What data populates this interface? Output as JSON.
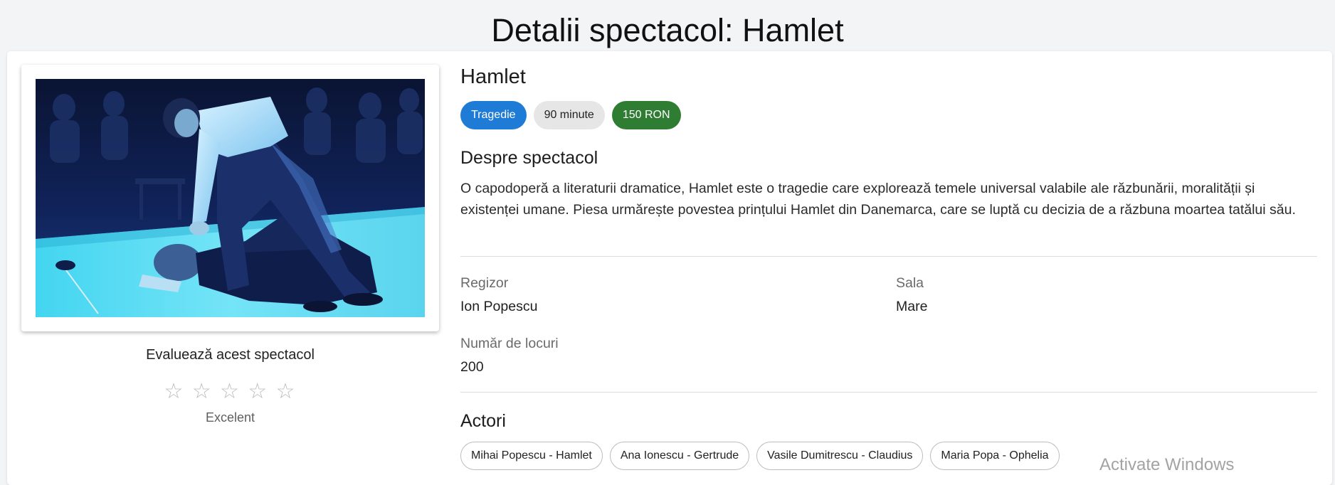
{
  "header": {
    "title": "Detalii spectacol: Hamlet"
  },
  "show": {
    "name": "Hamlet",
    "chips": {
      "genre": "Tragedie",
      "duration": "90 minute",
      "price": "150 RON"
    },
    "about_title": "Despre spectacol",
    "description": "O capodoperă a literaturii dramatice, Hamlet este o tragedie care explorează temele universal valabile ale răzbunării, moralității și existenței umane. Piesa urmărește povestea prințului Hamlet din Danemarca, care se luptă cu decizia de a răzbuna moartea tatălui său.",
    "director_label": "Regizor",
    "director": "Ion Popescu",
    "hall_label": "Sala",
    "hall": "Mare",
    "seats_label": "Număr de locuri",
    "seats": "200",
    "actors_title": "Actori",
    "actors": [
      "Mihai Popescu - Hamlet",
      "Ana Ionescu - Gertrude",
      "Vasile Dumitrescu - Claudius",
      "Maria Popa - Ophelia"
    ]
  },
  "rating": {
    "title": "Evaluează acest spectacol",
    "stars": [
      "☆",
      "☆",
      "☆",
      "☆",
      "☆"
    ],
    "value": 0,
    "max": 5,
    "caption": "Excelent"
  },
  "system": {
    "watermark": "Activate Windows"
  },
  "colors": {
    "genre_chip": "#1e7bd6",
    "price_chip": "#2e7d32",
    "duration_chip": "#e6e6e6"
  }
}
